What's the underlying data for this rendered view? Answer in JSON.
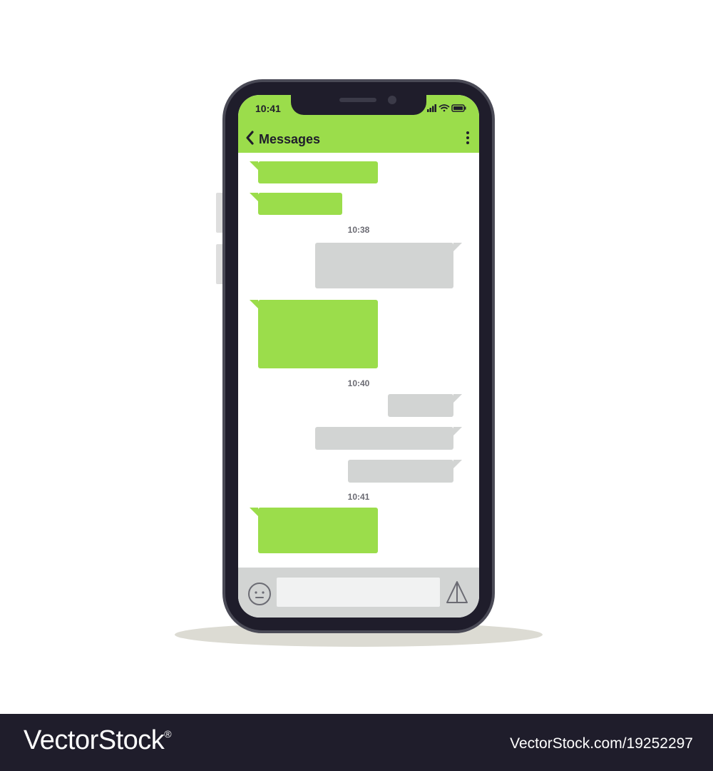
{
  "status": {
    "time": "10:41",
    "icons": [
      "signal-icon",
      "wifi-icon",
      "battery-icon"
    ]
  },
  "header": {
    "back_icon": "chevron-left-icon",
    "title": "Messages",
    "more_icon": "more-vertical-icon"
  },
  "timestamps": [
    "10:38",
    "10:40",
    "10:41"
  ],
  "composer": {
    "emoji_icon": "emoji-icon",
    "input_value": "",
    "send_icon": "send-icon"
  },
  "colors": {
    "accent": "#9bdd4b",
    "incoming": "#9bdd4b",
    "outgoing": "#d2d4d3",
    "frame": "#1f1d2b",
    "bottombar": "#d2d4d3"
  },
  "footer": {
    "brand": "VectorStock",
    "registered": "®",
    "url": "VectorStock.com/19252297"
  }
}
